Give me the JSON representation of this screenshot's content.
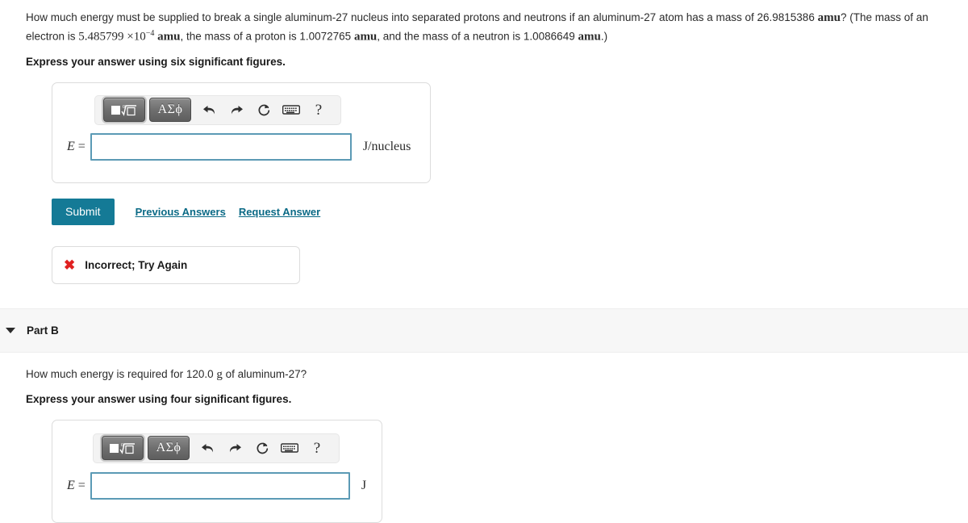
{
  "part_a": {
    "question_prefix": "How much energy must be supplied to break a single aluminum-27 nucleus into separated protons and neutrons if an aluminum-27 atom has a mass of ",
    "aluminum_mass": "26.9815386",
    "amu_1": "amu",
    "question_mid": "? (The mass of an electron is ",
    "electron_mass_mantissa": "5.485799",
    "times_symbol": "×",
    "electron_mass_base": "10",
    "electron_mass_exp": "−4",
    "amu_2": "amu",
    "question_mid2": ", the mass of a proton is ",
    "proton_mass": "1.0072765",
    "amu_3": "amu",
    "question_mid3": ", and the mass of a neutron is ",
    "neutron_mass": "1.0086649",
    "amu_4": "amu",
    "question_suffix": ".)",
    "instruction": "Express your answer using six significant figures.",
    "answer": {
      "variable_label_italic": "E",
      "variable_label_eq": "=",
      "value": "",
      "unit": "J/nucleus"
    },
    "toolbar": {
      "template_button": "template-math-button",
      "greek_button": "ΑΣϕ",
      "undo": "undo-icon",
      "redo": "redo-icon",
      "reset": "reset-icon",
      "keyboard": "keyboard-icon",
      "help": "?"
    },
    "submit_label": "Submit",
    "previous_answers_label": "Previous Answers",
    "request_answer_label": "Request Answer",
    "feedback": {
      "mark": "✖",
      "text": "Incorrect; Try Again"
    }
  },
  "part_b": {
    "title": "Part B",
    "question_prefix": "How much energy is required for 120.0 ",
    "gram_unit": "g",
    "question_suffix": " of aluminum-27?",
    "instruction": "Express your answer using four significant figures.",
    "answer": {
      "variable_label_italic": "E",
      "variable_label_eq": "=",
      "value": "",
      "unit": "J"
    },
    "toolbar": {
      "template_button": "template-math-button",
      "greek_button": "ΑΣϕ",
      "undo": "undo-icon",
      "redo": "redo-icon",
      "reset": "reset-icon",
      "keyboard": "keyboard-icon",
      "help": "?"
    }
  },
  "colors": {
    "submit_teal": "#147a96",
    "link_teal": "#0b6a86",
    "input_border": "#5b9ab5",
    "error_red": "#e02020",
    "band_gray": "#f7f7f7"
  }
}
